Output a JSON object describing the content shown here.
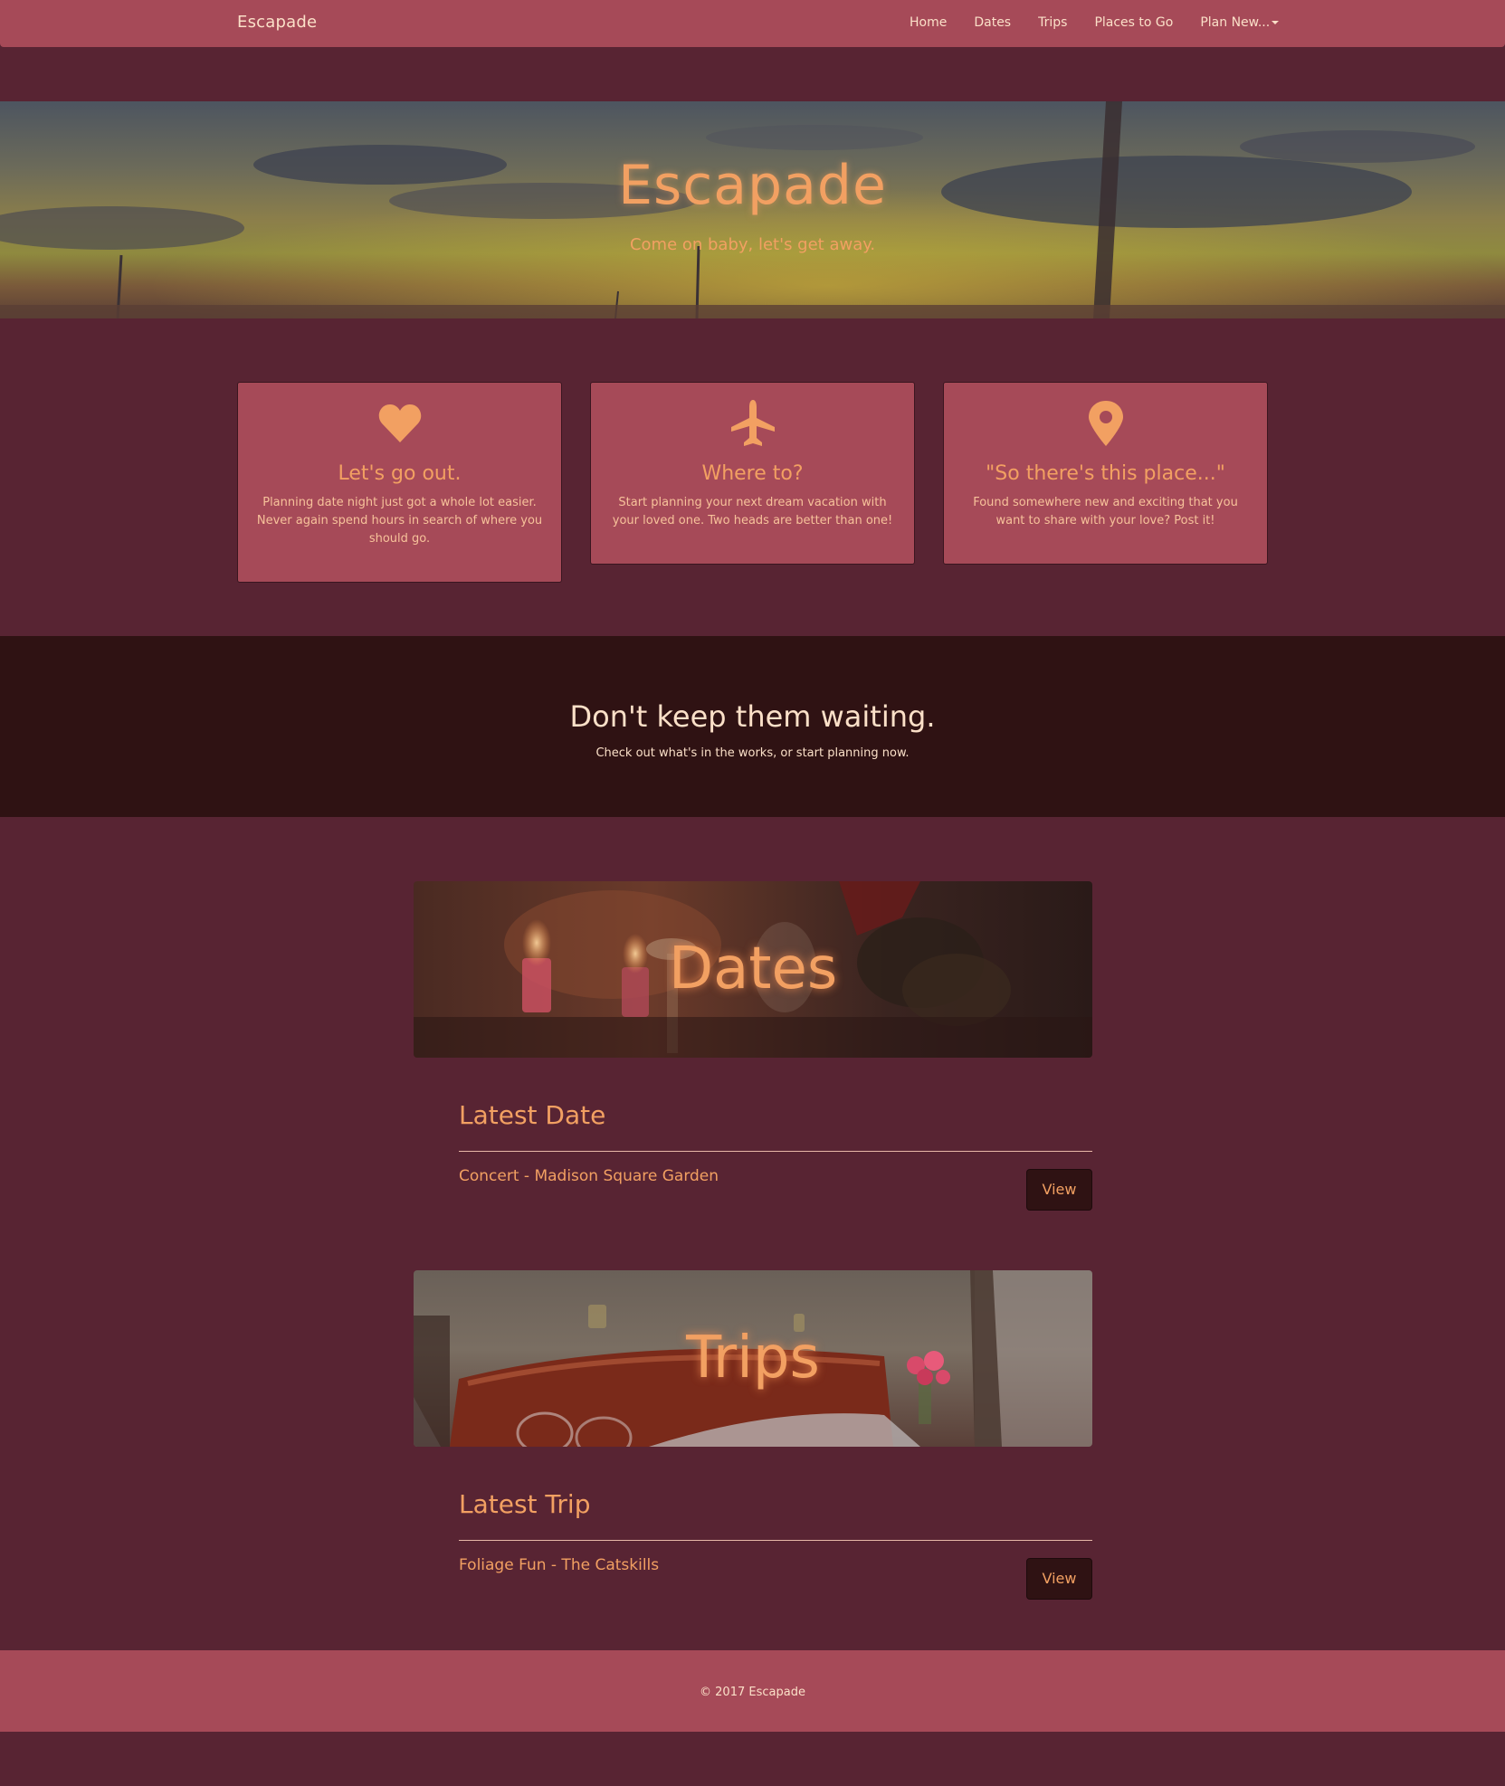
{
  "navbar": {
    "brand": "Escapade",
    "links": [
      "Home",
      "Dates",
      "Trips",
      "Places to Go",
      "Plan New..."
    ]
  },
  "hero": {
    "title": "Escapade",
    "subtitle": "Come on baby, let's get away."
  },
  "features": [
    {
      "icon": "heart-icon",
      "title": "Let's go out.",
      "text": "Planning date night just got a whole lot easier. Never again spend hours in search of where you should go."
    },
    {
      "icon": "plane-icon",
      "title": "Where to?",
      "text": "Start planning your next dream vacation with your loved one. Two heads are better than one!"
    },
    {
      "icon": "map-pin-icon",
      "title": "\"So there's this place...\"",
      "text": "Found somewhere new and exciting that you want to share with your love? Post it!"
    }
  ],
  "cta": {
    "heading": "Don't keep them waiting.",
    "text": "Check out what's in the works, or start planning now."
  },
  "dates": {
    "banner": "Dates",
    "heading": "Latest Date",
    "item": "Concert - Madison Square Garden",
    "button": "View"
  },
  "trips": {
    "banner": "Trips",
    "heading": "Latest Trip",
    "item": "Foliage Fun - The Catskills",
    "button": "View"
  },
  "footer": {
    "text": "© 2017 Escapade"
  },
  "colors": {
    "page_bg": "#582433",
    "nav_bg": "#a64a58",
    "accent": "#f2a062",
    "dark_band": "#2f1213"
  }
}
